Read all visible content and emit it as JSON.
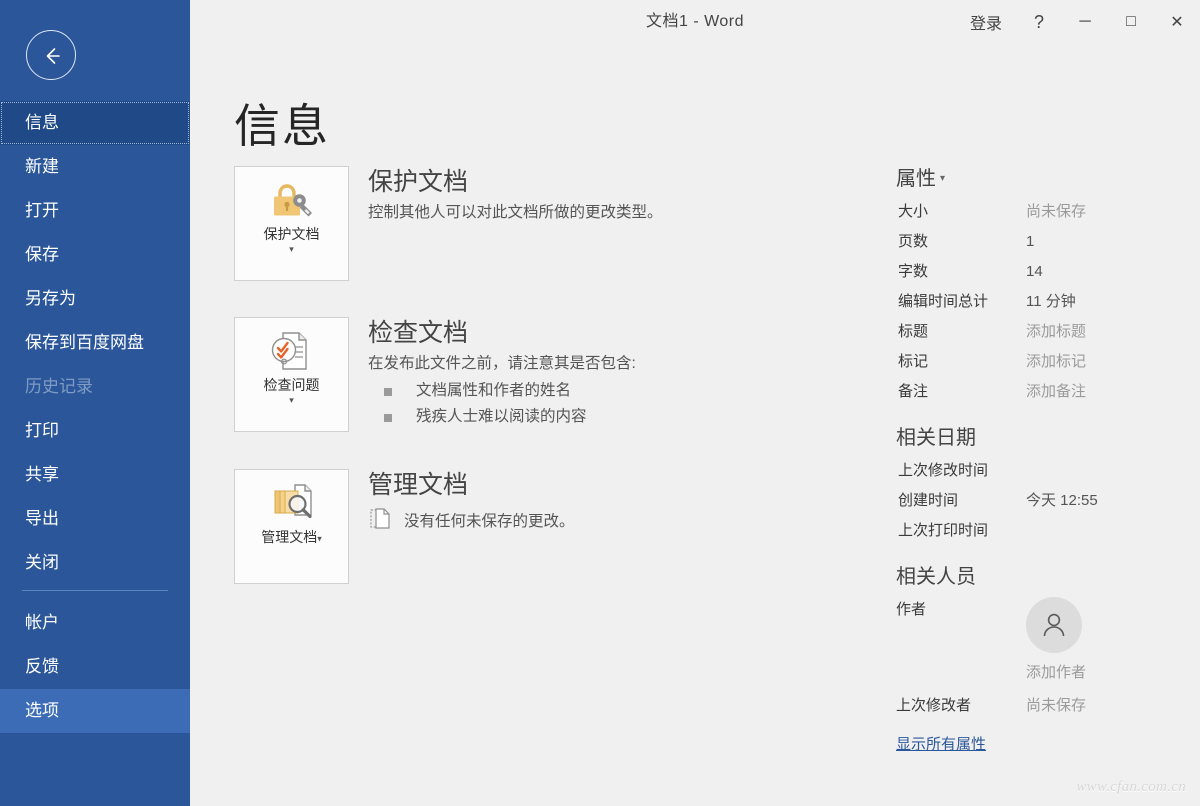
{
  "window": {
    "title": "文档1 - Word",
    "signin_label": "登录",
    "help_glyph": "?",
    "minimize_glyph": "─",
    "maximize_glyph": "□",
    "close_glyph": "✕"
  },
  "sidebar": {
    "back_icon": "back-arrow-icon",
    "accent_color": "#2b579a",
    "selected_color": "#204a87",
    "highlight_color": "#3b6cb5",
    "top_items": [
      {
        "label": "信息",
        "state": "selected"
      },
      {
        "label": "新建",
        "state": "normal"
      },
      {
        "label": "打开",
        "state": "normal"
      },
      {
        "label": "保存",
        "state": "normal"
      },
      {
        "label": "另存为",
        "state": "normal"
      },
      {
        "label": "保存到百度网盘",
        "state": "normal"
      },
      {
        "label": "历史记录",
        "state": "disabled"
      },
      {
        "label": "打印",
        "state": "normal"
      },
      {
        "label": "共享",
        "state": "normal"
      },
      {
        "label": "导出",
        "state": "normal"
      },
      {
        "label": "关闭",
        "state": "normal"
      }
    ],
    "bottom_items": [
      {
        "label": "帐户",
        "state": "normal"
      },
      {
        "label": "反馈",
        "state": "normal"
      },
      {
        "label": "选项",
        "state": "highlight"
      }
    ]
  },
  "main": {
    "page_title": "信息",
    "sections": [
      {
        "id": "protect",
        "button_label": "保护文档",
        "icon": "padlock-key-icon",
        "title": "保护文档",
        "description": "控制其他人可以对此文档所做的更改类型。",
        "bullets": []
      },
      {
        "id": "inspect",
        "button_label": "检查问题",
        "icon": "document-inspect-icon",
        "title": "检查文档",
        "description": "在发布此文件之前，请注意其是否包含:",
        "bullets": [
          "文档属性和作者的姓名",
          "残疾人士难以阅读的内容"
        ]
      },
      {
        "id": "manage",
        "button_label": "管理文档",
        "icon": "manage-documents-icon",
        "title": "管理文档",
        "description": "没有任何未保存的更改。",
        "status_icon": "unsaved-document-icon",
        "bullets": []
      }
    ]
  },
  "properties": {
    "heading": "属性",
    "rows": [
      {
        "key": "大小",
        "value": "尚未保存",
        "placeholder": true
      },
      {
        "key": "页数",
        "value": "1",
        "placeholder": false
      },
      {
        "key": "字数",
        "value": "14",
        "placeholder": false
      },
      {
        "key": "编辑时间总计",
        "value": "11 分钟",
        "placeholder": false
      },
      {
        "key": "标题",
        "value": "添加标题",
        "placeholder": true
      },
      {
        "key": "标记",
        "value": "添加标记",
        "placeholder": true
      },
      {
        "key": "备注",
        "value": "添加备注",
        "placeholder": true
      }
    ]
  },
  "dates": {
    "heading": "相关日期",
    "rows": [
      {
        "key": "上次修改时间",
        "value": ""
      },
      {
        "key": "创建时间",
        "value": "今天 12:55"
      },
      {
        "key": "上次打印时间",
        "value": ""
      }
    ]
  },
  "people": {
    "heading": "相关人员",
    "author_label": "作者",
    "add_author": "添加作者",
    "avatar_icon": "person-avatar-icon",
    "last_modified_by_label": "上次修改者",
    "last_modified_by_value": "尚未保存",
    "show_all_properties": "显示所有属性",
    "link_color": "#2b579a"
  },
  "watermark": "www.cfan.com.cn"
}
